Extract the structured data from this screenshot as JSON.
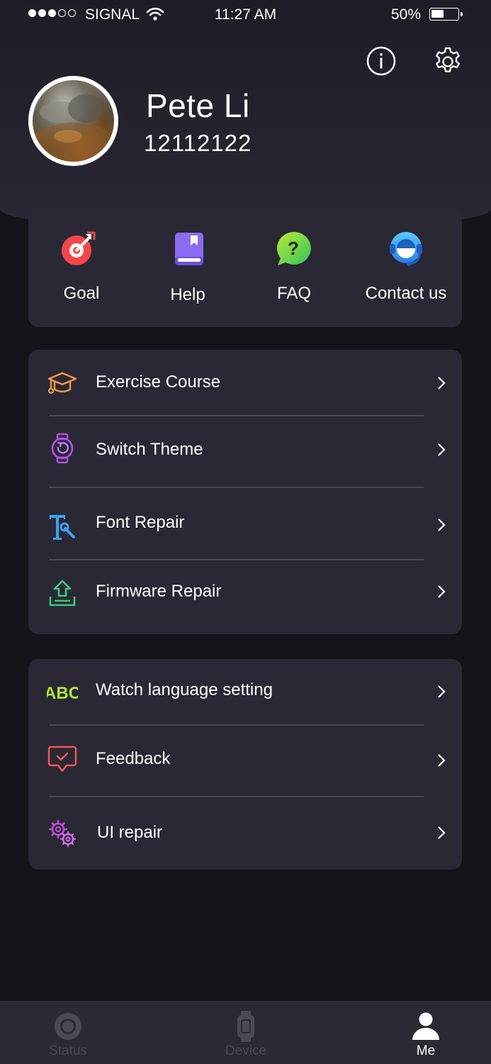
{
  "status_bar": {
    "carrier": "SIGNAL",
    "time": "11:27 AM",
    "battery": "50%"
  },
  "profile": {
    "name": "Pete Li",
    "id": "12112122"
  },
  "quick_actions": [
    {
      "label": "Goal",
      "icon": "goal-icon"
    },
    {
      "label": "Help",
      "icon": "help-book-icon"
    },
    {
      "label": "FAQ",
      "icon": "faq-bubble-icon"
    },
    {
      "label": "Contact us",
      "icon": "headset-icon"
    }
  ],
  "menu_group_1": [
    {
      "label": "Exercise Course",
      "icon": "graduation-cap-icon"
    },
    {
      "label": "Switch Theme",
      "icon": "watch-icon"
    },
    {
      "label": "Font Repair",
      "icon": "font-wrench-icon"
    },
    {
      "label": "Firmware Repair",
      "icon": "upload-tray-icon"
    }
  ],
  "menu_group_2": [
    {
      "label": "Watch language setting",
      "icon": "abc-icon",
      "icon_text": "ABC"
    },
    {
      "label": "Feedback",
      "icon": "feedback-chat-icon"
    },
    {
      "label": "UI repair",
      "icon": "gears-icon"
    }
  ],
  "tabs": [
    {
      "label": "Status",
      "active": false
    },
    {
      "label": "Device",
      "active": false
    },
    {
      "label": "Me",
      "active": true
    }
  ],
  "colors": {
    "background": "#15141b",
    "card": "#2a2834",
    "tabbar": "#2b2a33",
    "goal": "#f5464a",
    "help": "#8b6cf0",
    "faq": "#7fdd3a",
    "contact": "#39a6f3",
    "course": "#f39a45",
    "theme": "#b44fe6",
    "font": "#3aa4f0",
    "firmware": "#3fc87e",
    "language": "#b6e23a",
    "feedback": "#f0585a",
    "ui_repair": "#c24ee0"
  }
}
